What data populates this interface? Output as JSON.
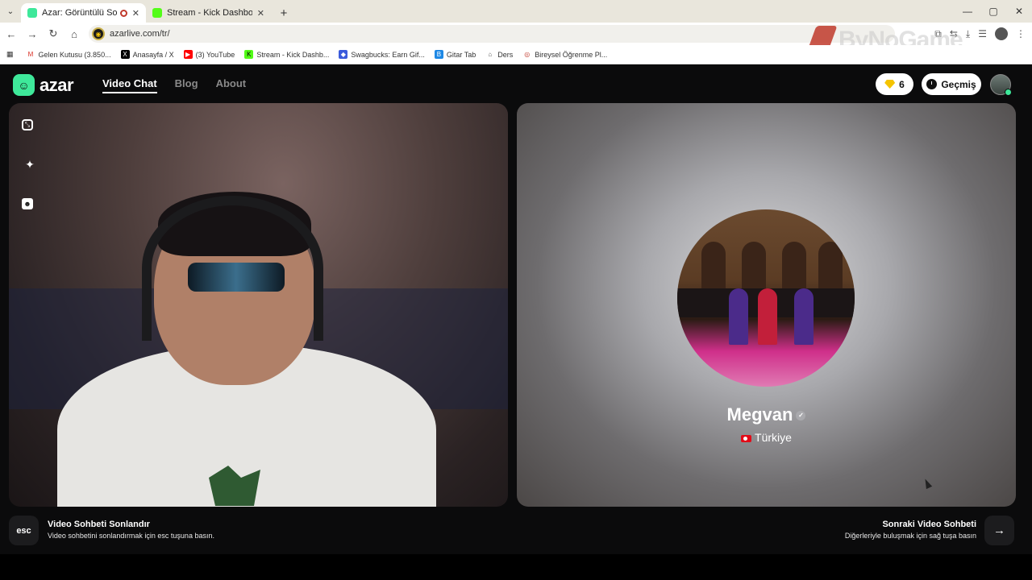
{
  "browser": {
    "tabs": [
      {
        "title": "Azar: Görüntülü Sohbet & V",
        "active": true,
        "recording": true
      },
      {
        "title": "Stream - Kick Dashboard",
        "active": false
      }
    ],
    "new_tab_symbol": "+",
    "url": "azarlive.com/tr/",
    "window_controls": [
      "minimize",
      "maximize",
      "close"
    ],
    "bookmarks": [
      {
        "label": "Gelen Kutusu (3.850...",
        "icon": "gmail-icon"
      },
      {
        "label": "Anasayfa / X",
        "icon": "x-icon"
      },
      {
        "label": "(3) YouTube",
        "icon": "youtube-icon"
      },
      {
        "label": "Stream - Kick Dashb...",
        "icon": "kick-icon"
      },
      {
        "label": "Swagbucks: Earn Gif...",
        "icon": "swagbucks-icon"
      },
      {
        "label": "Gitar Tab",
        "icon": "bookmark-icon"
      },
      {
        "label": "Ders",
        "icon": "home-icon"
      },
      {
        "label": "Bireysel Öğrenme Pl...",
        "icon": "globe-icon"
      }
    ],
    "watermark": "ByNoGame"
  },
  "app": {
    "logo_text": "azar",
    "nav": [
      {
        "label": "Video Chat",
        "active": true
      },
      {
        "label": "Blog",
        "active": false
      },
      {
        "label": "About",
        "active": false
      }
    ],
    "gems_count": "6",
    "history_label": "Geçmiş",
    "accent_color": "#3ee89a"
  },
  "partner": {
    "name": "Megvan",
    "country": "Türkiye"
  },
  "controls": {
    "esc_key": "esc",
    "end_title": "Video Sohbeti Sonlandır",
    "end_subtitle": "Video sohbetini sonlandırmak için esc tuşuna basın.",
    "next_title": "Sonraki Video Sohbeti",
    "next_subtitle": "Diğerleriyle buluşmak için sağ tuşa basın"
  }
}
